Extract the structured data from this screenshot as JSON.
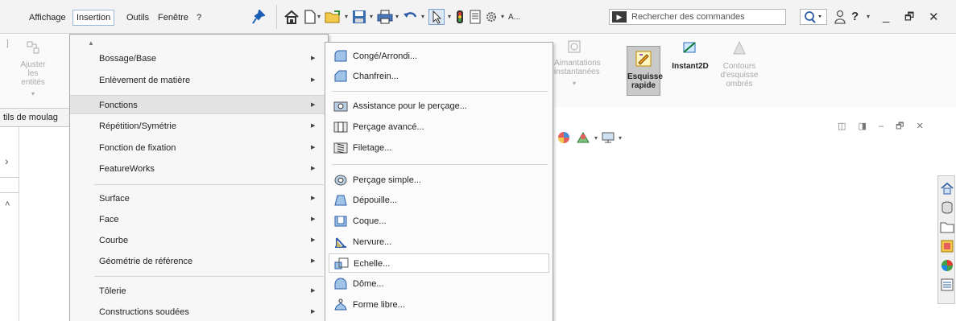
{
  "menubar": {
    "items": [
      {
        "label": "Affichage"
      },
      {
        "label": "Insertion"
      },
      {
        "label": "Outils"
      },
      {
        "label": "Fenêtre"
      },
      {
        "label": "?"
      }
    ],
    "search_placeholder": "Rechercher des commandes",
    "help_label": "?",
    "window_buttons": {
      "minimize": "_",
      "restore": "🗗",
      "close": "✕"
    },
    "ellipsis_label": "A..."
  },
  "ribbon": {
    "ajuster": "Ajuster les entités",
    "aimantations": "Aimantations instantanées",
    "esquisse_rapide": "Esquisse rapide",
    "instant2d": "Instant2D",
    "contours": "Contours d'esquisse ombrés"
  },
  "tab_strip_label": "tils de moulag",
  "insertion_menu": {
    "items": [
      {
        "label": "Bossage/Base"
      },
      {
        "label": "Enlèvement de matière"
      },
      {
        "label": "Fonctions"
      },
      {
        "label": "Répétition/Symétrie"
      },
      {
        "label": "Fonction de fixation"
      },
      {
        "label": "FeatureWorks"
      },
      {
        "label": "Surface"
      },
      {
        "label": "Face"
      },
      {
        "label": "Courbe"
      },
      {
        "label": "Géométrie de référence"
      },
      {
        "label": "Tôlerie"
      },
      {
        "label": "Constructions soudées"
      }
    ]
  },
  "fonctions_menu": {
    "items": [
      {
        "label": "Congé/Arrondi..."
      },
      {
        "label": "Chanfrein..."
      },
      {
        "label": "Assistance pour le perçage..."
      },
      {
        "label": "Perçage avancé..."
      },
      {
        "label": "Filetage..."
      },
      {
        "label": "Perçage simple..."
      },
      {
        "label": "Dépouille..."
      },
      {
        "label": "Coque..."
      },
      {
        "label": "Nervure..."
      },
      {
        "label": "Echelle..."
      },
      {
        "label": "Dôme..."
      },
      {
        "label": "Forme libre..."
      }
    ]
  },
  "colors": {
    "accent_blue": "#1b5fb4",
    "menu_highlight": "#e3e3e3",
    "pressed_button": "#c9c9c9"
  }
}
